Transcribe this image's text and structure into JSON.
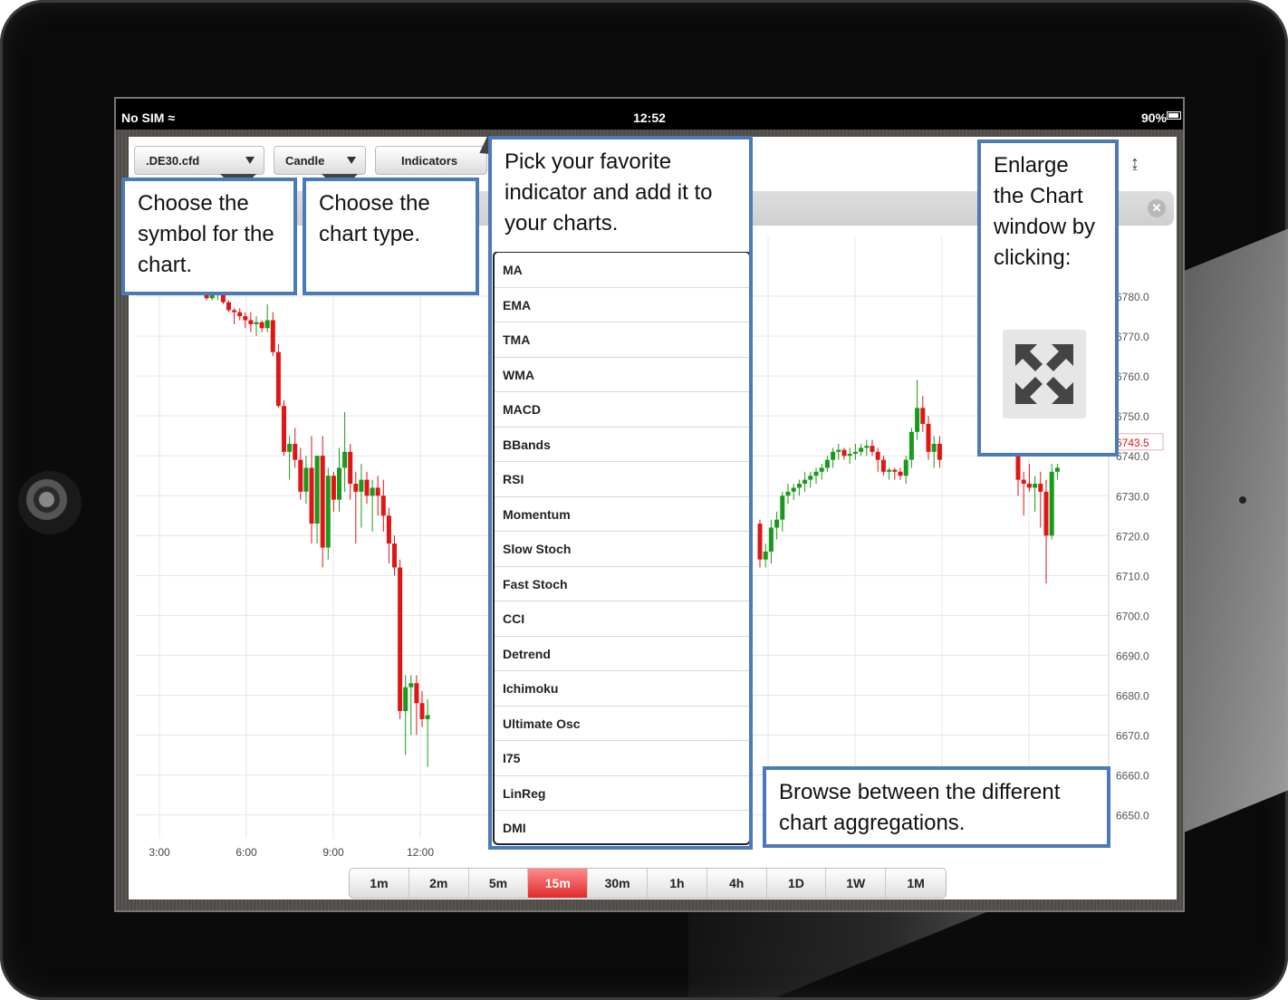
{
  "statusbar": {
    "carrier": "No SIM",
    "time": "12:52",
    "battery": "90%"
  },
  "toolbar": {
    "symbol": ".DE30.cfd",
    "chart_type": "Candle",
    "indicators": "Indicators"
  },
  "indicators_menu": [
    "MA",
    "EMA",
    "TMA",
    "WMA",
    "MACD",
    "BBands",
    "RSI",
    "Momentum",
    "Slow Stoch",
    "Fast Stoch",
    "CCI",
    "Detrend",
    "Ichimoku",
    "Ultimate Osc",
    "I75",
    "LinReg",
    "DMI"
  ],
  "timeframes": [
    "1m",
    "2m",
    "5m",
    "15m",
    "30m",
    "1h",
    "4h",
    "1D",
    "1W",
    "1M"
  ],
  "active_timeframe": "15m",
  "callouts": {
    "symbol": "Choose the symbol for the chart.",
    "chart_type": "Choose the chart type.",
    "indicators": "Pick your favorite indicator and add it to your charts.",
    "enlarge": "Enlarge the Chart window by clicking:",
    "browse": "Browse between the different chart aggregations."
  },
  "chart_data": {
    "type": "candlestick",
    "x_tick_labels": [
      "3:00",
      "6:00",
      "9:00",
      "12:00"
    ],
    "y_tick_labels": [
      "6780.0",
      "6770.0",
      "6760.0",
      "6750.0",
      "6740.0",
      "6730.0",
      "6720.0",
      "6710.0",
      "6700.0",
      "6690.0",
      "6680.0",
      "6670.0",
      "6660.0",
      "6650.0"
    ],
    "y_ticks": [
      6780,
      6770,
      6760,
      6750,
      6740,
      6730,
      6720,
      6710,
      6700,
      6690,
      6680,
      6670,
      6660,
      6650
    ],
    "ylim": [
      6644,
      6795
    ],
    "current_price_label": "6743.5",
    "current_price": 6743.5,
    "colors": {
      "up": "#1a9a1a",
      "down": "#e01515",
      "current": "#e01515"
    },
    "candles_left": [
      [
        6783,
        6785,
        6781,
        6782
      ],
      [
        6782,
        6783,
        6779,
        6779.5
      ],
      [
        6779.5,
        6781,
        6779,
        6780.5
      ],
      [
        6780.5,
        6782,
        6779,
        6781
      ],
      [
        6781,
        6781.5,
        6778,
        6778.5
      ],
      [
        6778.5,
        6779,
        6776,
        6776.5
      ],
      [
        6776.5,
        6777,
        6773,
        6776
      ],
      [
        6776,
        6777,
        6774,
        6775
      ],
      [
        6775,
        6776,
        6772,
        6774
      ],
      [
        6774,
        6776,
        6771,
        6773
      ],
      [
        6773,
        6775,
        6770,
        6773.5
      ],
      [
        6773.5,
        6774,
        6771,
        6772
      ],
      [
        6772,
        6778,
        6771,
        6774
      ],
      [
        6774,
        6776,
        6765,
        6766
      ],
      [
        6766,
        6768,
        6752,
        6752.5
      ],
      [
        6752.5,
        6754,
        6740,
        6741
      ],
      [
        6741,
        6745,
        6734,
        6743
      ],
      [
        6743,
        6747,
        6737,
        6739
      ],
      [
        6739,
        6742,
        6729,
        6731
      ],
      [
        6731,
        6740,
        6728,
        6737
      ],
      [
        6737,
        6745,
        6718,
        6723
      ],
      [
        6723,
        6740,
        6718,
        6740
      ],
      [
        6740,
        6745,
        6712,
        6717
      ],
      [
        6717,
        6737,
        6714,
        6735
      ],
      [
        6735,
        6736,
        6726,
        6729
      ],
      [
        6729,
        6742,
        6726,
        6737
      ],
      [
        6737,
        6751,
        6731,
        6741
      ],
      [
        6741,
        6743,
        6729,
        6733
      ],
      [
        6733,
        6736,
        6718,
        6731
      ],
      [
        6731,
        6738,
        6722,
        6734
      ],
      [
        6734,
        6736,
        6728,
        6730
      ],
      [
        6730,
        6734,
        6721,
        6732
      ],
      [
        6732,
        6735,
        6725,
        6730
      ],
      [
        6730,
        6734,
        6721,
        6725
      ],
      [
        6725,
        6727,
        6713,
        6718
      ],
      [
        6718,
        6720,
        6710,
        6712
      ],
      [
        6712,
        6714,
        6674,
        6676
      ],
      [
        6676,
        6685,
        6665,
        6682
      ],
      [
        6682,
        6685,
        6670,
        6683
      ],
      [
        6683,
        6685,
        6670,
        6678
      ],
      [
        6678,
        6681,
        6672,
        6674
      ],
      [
        6674,
        6679,
        6662,
        6675
      ]
    ],
    "candles_right": [
      [
        6723,
        6724,
        6712,
        6714
      ],
      [
        6714,
        6718,
        6712,
        6716
      ],
      [
        6716,
        6724,
        6713,
        6722
      ],
      [
        6722,
        6726,
        6719,
        6724
      ],
      [
        6724,
        6731,
        6721,
        6730
      ],
      [
        6730,
        6733,
        6728,
        6731
      ],
      [
        6731,
        6733,
        6729,
        6732
      ],
      [
        6732,
        6734,
        6730,
        6733
      ],
      [
        6733,
        6736,
        6731,
        6734
      ],
      [
        6734,
        6736,
        6732,
        6735
      ],
      [
        6735,
        6737,
        6733,
        6736
      ],
      [
        6736,
        6738,
        6734,
        6737
      ],
      [
        6737,
        6740,
        6736,
        6739
      ],
      [
        6739,
        6742,
        6737,
        6741
      ],
      [
        6741,
        6743,
        6739,
        6741.5
      ],
      [
        6741.5,
        6742,
        6739,
        6740
      ],
      [
        6740,
        6742,
        6738,
        6740.5
      ],
      [
        6740.5,
        6743,
        6739,
        6741
      ],
      [
        6741,
        6743,
        6740,
        6742
      ],
      [
        6742,
        6744,
        6740,
        6742.5
      ],
      [
        6742.5,
        6744,
        6740,
        6741
      ],
      [
        6741,
        6742,
        6736,
        6739
      ],
      [
        6739,
        6740,
        6735,
        6736
      ],
      [
        6736,
        6737,
        6734,
        6736.5
      ],
      [
        6736.5,
        6737,
        6734,
        6736
      ],
      [
        6736,
        6737,
        6734,
        6735
      ],
      [
        6735,
        6740,
        6733,
        6739
      ],
      [
        6739,
        6747,
        6737,
        6746
      ],
      [
        6746,
        6759,
        6744,
        6752
      ],
      [
        6752,
        6755,
        6746,
        6748
      ],
      [
        6748,
        6750,
        6739,
        6741
      ],
      [
        6741,
        6745,
        6737,
        6743
      ],
      [
        6743,
        6745,
        6737,
        6739
      ]
    ],
    "candles_far_right": [
      [
        6740,
        6743,
        6730,
        6734
      ],
      [
        6734,
        6736,
        6725,
        6733
      ],
      [
        6733,
        6738,
        6731,
        6732
      ],
      [
        6732,
        6735,
        6726,
        6733
      ],
      [
        6733,
        6736,
        6722,
        6731
      ],
      [
        6731,
        6734,
        6708,
        6720
      ],
      [
        6720,
        6738,
        6719,
        6736
      ],
      [
        6736,
        6738,
        6734,
        6737
      ]
    ]
  }
}
